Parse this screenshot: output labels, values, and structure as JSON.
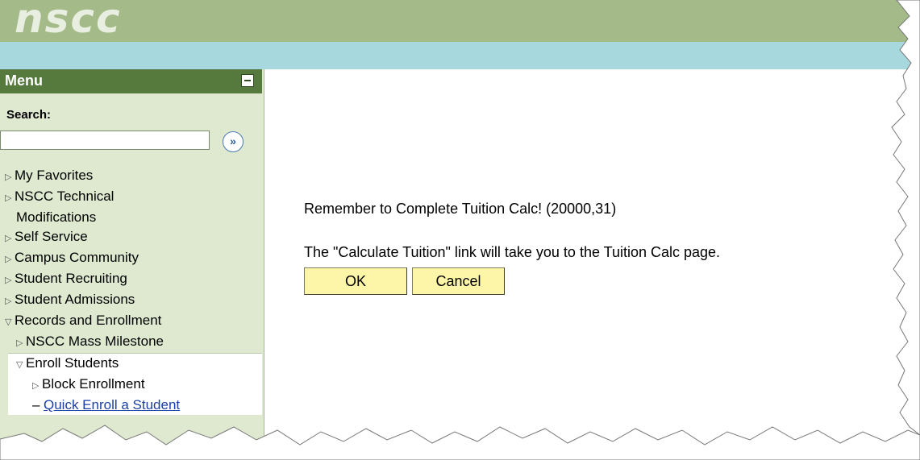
{
  "header": {
    "logo_text": "nscc"
  },
  "menu": {
    "title": "Menu",
    "collapse_icon": "minus-icon",
    "search_label": "Search:",
    "search_value": "",
    "search_go_glyph": "»",
    "items": [
      {
        "label": "My Favorites"
      },
      {
        "label": "NSCC Technical",
        "label2": "Modifications"
      },
      {
        "label": "Self Service"
      },
      {
        "label": "Campus Community"
      },
      {
        "label": "Student Recruiting"
      },
      {
        "label": "Student Admissions"
      },
      {
        "label": "Records and Enrollment"
      }
    ],
    "sub_items": [
      {
        "label": "NSCC Mass Milestone"
      }
    ],
    "enroll": {
      "label": "Enroll Students",
      "children": [
        {
          "label": "Block Enrollment"
        }
      ],
      "link": "Quick Enroll a Student"
    }
  },
  "dialog": {
    "message1": "Remember to Complete Tuition Calc! (20000,31)",
    "message2": "The \"Calculate Tuition\" link will take you to the Tuition Calc page.",
    "ok_label": "OK",
    "cancel_label": "Cancel"
  },
  "colors": {
    "header_green": "#a4bb89",
    "header_blue": "#a7d8de",
    "menu_header": "#567a3d",
    "sidebar_bg": "#dfe9d0",
    "button_bg": "#fdf6a9",
    "link": "#1a3fa7"
  }
}
